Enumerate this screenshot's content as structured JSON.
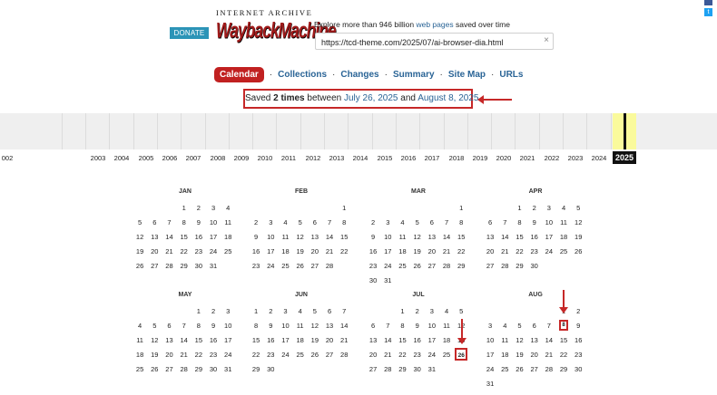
{
  "header": {
    "donate_label": "DONATE",
    "logo_top": "INTERNET ARCHIVE",
    "logo_main": "WaybackMachine",
    "tagline_pre": "Explore more than 946 billion",
    "tagline_link": "web pages",
    "tagline_post": "saved over time",
    "url_value": "https://tcd-theme.com/2025/07/ai-browser-dia.html",
    "clear_icon": "×"
  },
  "social": {
    "twitter_glyph": "t"
  },
  "nav": {
    "items": [
      {
        "label": "Calendar",
        "active": true
      },
      {
        "label": "Collections"
      },
      {
        "label": "Changes"
      },
      {
        "label": "Summary"
      },
      {
        "label": "Site Map"
      },
      {
        "label": "URLs"
      }
    ],
    "separator": "·"
  },
  "saved": {
    "prefix": "Saved",
    "count": "2 times",
    "between": "between",
    "start_date": "July 26, 2025",
    "and": "and",
    "end_date": "August 8, 2025",
    "suffix": "."
  },
  "timeline": {
    "years": [
      "002",
      "2003",
      "2004",
      "2005",
      "2006",
      "2007",
      "2008",
      "2009",
      "2010",
      "2011",
      "2012",
      "2013",
      "2014",
      "2015",
      "2016",
      "2017",
      "2018",
      "2019",
      "2020",
      "2021",
      "2022",
      "2023",
      "2024",
      "2025"
    ],
    "current": "2025"
  },
  "calendar": {
    "months": [
      {
        "name": "JAN",
        "weeks": [
          [
            "",
            "",
            "",
            "1",
            "2",
            "3",
            "4"
          ],
          [
            "5",
            "6",
            "7",
            "8",
            "9",
            "10",
            "11"
          ],
          [
            "12",
            "13",
            "14",
            "15",
            "16",
            "17",
            "18"
          ],
          [
            "19",
            "20",
            "21",
            "22",
            "23",
            "24",
            "25"
          ],
          [
            "26",
            "27",
            "28",
            "29",
            "30",
            "31",
            ""
          ]
        ]
      },
      {
        "name": "FEB",
        "weeks": [
          [
            "",
            "",
            "",
            "",
            "",
            "",
            "1"
          ],
          [
            "2",
            "3",
            "4",
            "5",
            "6",
            "7",
            "8"
          ],
          [
            "9",
            "10",
            "11",
            "12",
            "13",
            "14",
            "15"
          ],
          [
            "16",
            "17",
            "18",
            "19",
            "20",
            "21",
            "22"
          ],
          [
            "23",
            "24",
            "25",
            "26",
            "27",
            "28",
            ""
          ]
        ]
      },
      {
        "name": "MAR",
        "weeks": [
          [
            "",
            "",
            "",
            "",
            "",
            "",
            "1"
          ],
          [
            "2",
            "3",
            "4",
            "5",
            "6",
            "7",
            "8"
          ],
          [
            "9",
            "10",
            "11",
            "12",
            "13",
            "14",
            "15"
          ],
          [
            "16",
            "17",
            "18",
            "19",
            "20",
            "21",
            "22"
          ],
          [
            "23",
            "24",
            "25",
            "26",
            "27",
            "28",
            "29"
          ],
          [
            "30",
            "31",
            "",
            "",
            "",
            "",
            ""
          ]
        ]
      },
      {
        "name": "APR",
        "weeks": [
          [
            "",
            "",
            "1",
            "2",
            "3",
            "4",
            "5"
          ],
          [
            "6",
            "7",
            "8",
            "9",
            "10",
            "11",
            "12"
          ],
          [
            "13",
            "14",
            "15",
            "16",
            "17",
            "18",
            "19"
          ],
          [
            "20",
            "21",
            "22",
            "23",
            "24",
            "25",
            "26"
          ],
          [
            "27",
            "28",
            "29",
            "30",
            "",
            "",
            ""
          ]
        ]
      },
      {
        "name": "MAY",
        "weeks": [
          [
            "",
            "",
            "",
            "",
            "1",
            "2",
            "3"
          ],
          [
            "4",
            "5",
            "6",
            "7",
            "8",
            "9",
            "10"
          ],
          [
            "11",
            "12",
            "13",
            "14",
            "15",
            "16",
            "17"
          ],
          [
            "18",
            "19",
            "20",
            "21",
            "22",
            "23",
            "24"
          ],
          [
            "25",
            "26",
            "27",
            "28",
            "29",
            "30",
            "31"
          ]
        ]
      },
      {
        "name": "JUN",
        "weeks": [
          [
            "1",
            "2",
            "3",
            "4",
            "5",
            "6",
            "7"
          ],
          [
            "8",
            "9",
            "10",
            "11",
            "12",
            "13",
            "14"
          ],
          [
            "15",
            "16",
            "17",
            "18",
            "19",
            "20",
            "21"
          ],
          [
            "22",
            "23",
            "24",
            "25",
            "26",
            "27",
            "28"
          ],
          [
            "29",
            "30",
            "",
            "",
            "",
            "",
            ""
          ]
        ]
      },
      {
        "name": "JUL",
        "weeks": [
          [
            "",
            "",
            "1",
            "2",
            "3",
            "4",
            "5"
          ],
          [
            "6",
            "7",
            "8",
            "9",
            "10",
            "11",
            "12"
          ],
          [
            "13",
            "14",
            "15",
            "16",
            "17",
            "18",
            "19"
          ],
          [
            "20",
            "21",
            "22",
            "23",
            "24",
            "25",
            "26"
          ],
          [
            "27",
            "28",
            "29",
            "30",
            "31",
            "",
            ""
          ]
        ]
      },
      {
        "name": "AUG",
        "weeks": [
          [
            "",
            "",
            "",
            "",
            "",
            "1",
            "2"
          ],
          [
            "3",
            "4",
            "5",
            "6",
            "7",
            "8",
            "9"
          ],
          [
            "10",
            "11",
            "12",
            "13",
            "14",
            "15",
            "16"
          ],
          [
            "17",
            "18",
            "19",
            "20",
            "21",
            "22",
            "23"
          ],
          [
            "24",
            "25",
            "26",
            "27",
            "28",
            "29",
            "30"
          ],
          [
            "31",
            "",
            "",
            "",
            "",
            "",
            ""
          ]
        ]
      }
    ],
    "snapshots": {
      "JUL": [
        "26"
      ],
      "AUG": [
        "8"
      ]
    }
  }
}
